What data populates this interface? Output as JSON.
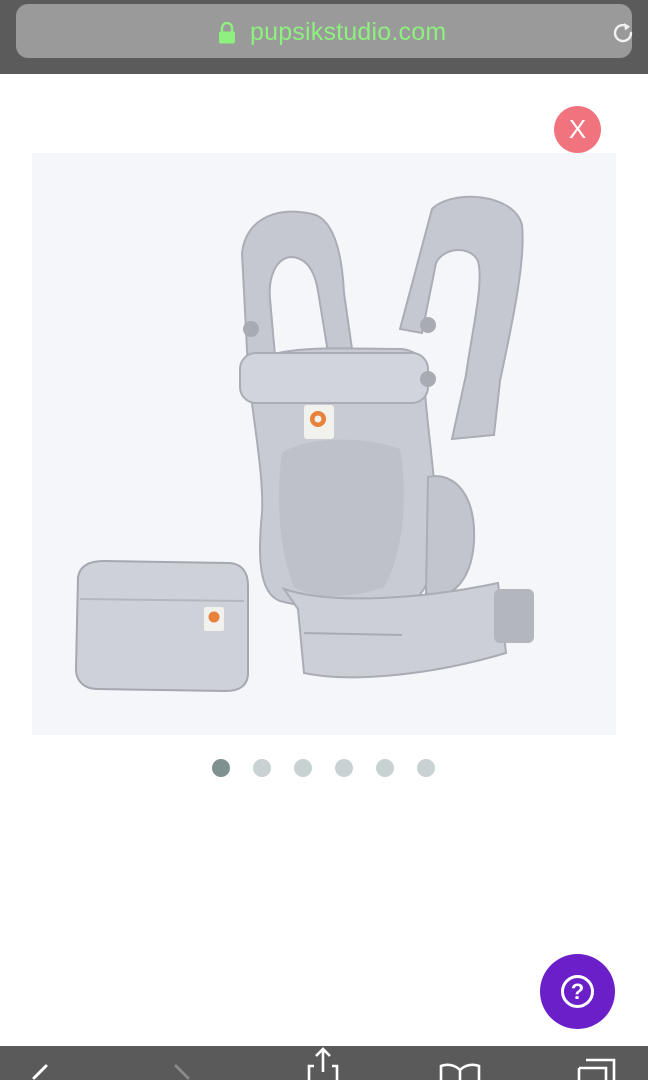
{
  "browser": {
    "url": "pupsikstudio.com",
    "lock_icon": "lock-icon",
    "reload_icon": "reload-icon",
    "url_color": "#8ef07e"
  },
  "modal": {
    "close_label": "X",
    "close_color": "#f1737e",
    "image_alt": "Baby carrier with waist pouch",
    "carousel": {
      "total": 6,
      "active_index": 0
    }
  },
  "help": {
    "icon": "question-circle-icon",
    "label": "?",
    "color": "#6a1fc8"
  },
  "toolbar": {
    "icons": [
      "back-icon",
      "forward-icon",
      "share-icon",
      "bookmarks-icon",
      "tabs-icon"
    ]
  }
}
